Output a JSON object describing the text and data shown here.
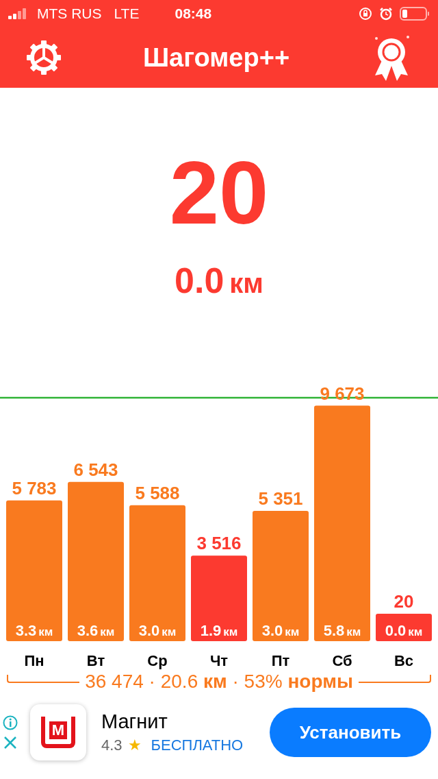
{
  "status_bar": {
    "carrier": "MTS RUS",
    "network": "LTE",
    "time": "08:48"
  },
  "header": {
    "title": "Шагомер++"
  },
  "today": {
    "steps": "20",
    "distance": "0.0",
    "unit": "км"
  },
  "week_chart": {
    "chart_data": {
      "type": "bar",
      "categories": [
        "Пн",
        "Вт",
        "Ср",
        "Чт",
        "Пт",
        "Сб",
        "Вс"
      ],
      "values": [
        5783,
        6543,
        5588,
        3516,
        5351,
        9673,
        20
      ],
      "value_labels": [
        "5 783",
        "6 543",
        "5 588",
        "3 516",
        "5 351",
        "9 673",
        "20"
      ]
    },
    "bars": [
      {
        "distance": "3.3",
        "unit": "км",
        "color": "#f97a1f"
      },
      {
        "distance": "3.6",
        "unit": "км",
        "color": "#f97a1f"
      },
      {
        "distance": "3.0",
        "unit": "км",
        "color": "#f97a1f"
      },
      {
        "distance": "1.9",
        "unit": "км",
        "color": "#fc3a30"
      },
      {
        "distance": "3.0",
        "unit": "км",
        "color": "#f97a1f"
      },
      {
        "distance": "5.8",
        "unit": "км",
        "color": "#f97a1f"
      },
      {
        "distance": "0.0",
        "unit": "км",
        "color": "#fc3a30"
      }
    ]
  },
  "summary": "36 474 · 20.6 **км** · 53% **нормы**",
  "ad": {
    "logo_letter": "М",
    "app_name": "Магнит",
    "rating": "4.3",
    "star": "★",
    "price": "БЕСПЛАТНО",
    "button": "Установить"
  }
}
